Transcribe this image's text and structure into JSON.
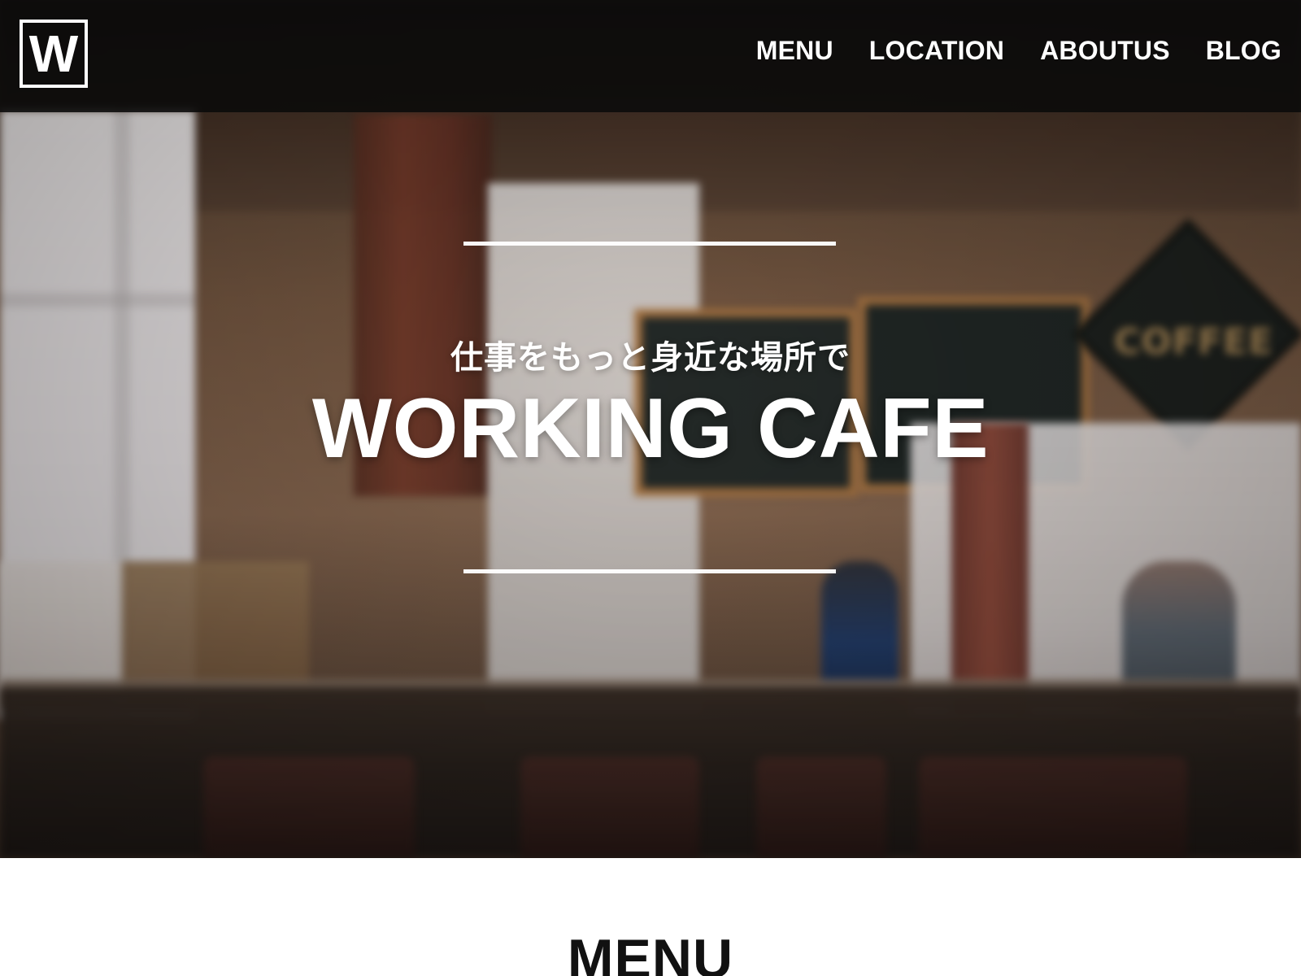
{
  "header": {
    "logo_text": "W",
    "nav": [
      {
        "label": "MENU"
      },
      {
        "label": "LOCATION"
      },
      {
        "label": "ABOUTUS"
      },
      {
        "label": "BLOG"
      }
    ]
  },
  "hero": {
    "subtitle": "仕事をもっと身近な場所で",
    "title": "WORKING CAFE",
    "scene_text": {
      "coffee_sign": "COFFEE"
    }
  },
  "sections": {
    "menu_title": "MENU"
  }
}
